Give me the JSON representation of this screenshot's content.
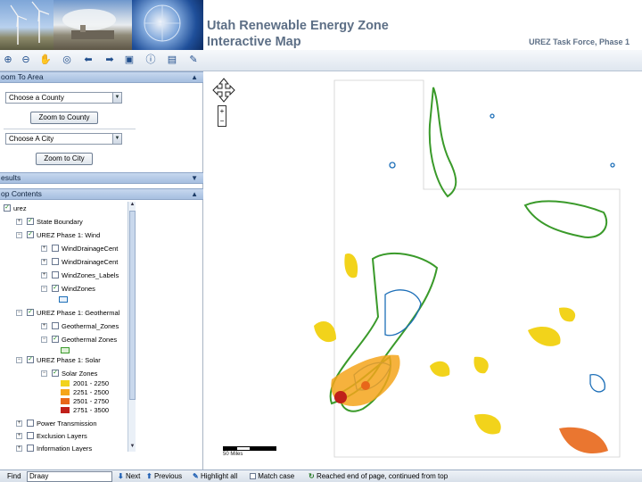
{
  "header": {
    "title": "Utah Renewable Energy Zone\nInteractive Map",
    "subtitle": "UREZ Task Force, Phase 1"
  },
  "toolbar": {
    "tools": [
      "zoom-in-icon",
      "zoom-out-icon",
      "pan-hand-icon",
      "globe-icon",
      "back-arrow-icon",
      "forward-arrow-icon",
      "identify-icon",
      "info-icon",
      "print-icon",
      "export-icon"
    ]
  },
  "zoom_panel": {
    "header": "oom To Area",
    "county_select": "Choose a County",
    "county_button": "Zoom to County",
    "city_select": "Choose A City",
    "city_button": "Zoom to City"
  },
  "results_panel": {
    "header": "esults"
  },
  "toc": {
    "header": "op Contents",
    "root": "urez",
    "items": [
      {
        "label": "State Boundary",
        "checked": true
      },
      {
        "label": "UREZ Phase 1: Wind",
        "checked": true
      },
      {
        "label": "WindDrainageCent",
        "checked": false
      },
      {
        "label": "WindDrainageCent",
        "checked": false
      },
      {
        "label": "WindZones_Labels",
        "checked": false
      },
      {
        "label": "WindZones",
        "checked": true
      },
      {
        "label": "UREZ Phase 1: Geothermal",
        "checked": true
      },
      {
        "label": "Geothermal_Zones",
        "checked": false
      },
      {
        "label": "Geothermal Zones",
        "checked": true
      },
      {
        "label": "UREZ Phase 1: Solar",
        "checked": true
      },
      {
        "label": "Solar Zones",
        "checked": true
      },
      {
        "label": "Power Transmission",
        "checked": false
      },
      {
        "label": "Exclusion Layers",
        "checked": false
      },
      {
        "label": "Information Layers",
        "checked": false
      }
    ],
    "legend": [
      {
        "label": "2001 - 2250",
        "color": "#f2d31b"
      },
      {
        "label": "2251 - 2500",
        "color": "#f5a51b"
      },
      {
        "label": "2501 - 2750",
        "color": "#e8671a"
      },
      {
        "label": "2751 - 3500",
        "color": "#c0201a"
      }
    ]
  },
  "map": {
    "scale_label": "50 Miles",
    "colors": {
      "wind": "#3a9a2a",
      "geo": "#1d6fb8",
      "solar_low": "#f2d31b",
      "solar_high": "#c0201a"
    }
  },
  "findbar": {
    "label": "Find",
    "value": "Draay",
    "next": "Next",
    "previous": "Previous",
    "highlight": "Highlight all",
    "match_case": "Match case",
    "status": "Reached end of page, continued from top"
  }
}
